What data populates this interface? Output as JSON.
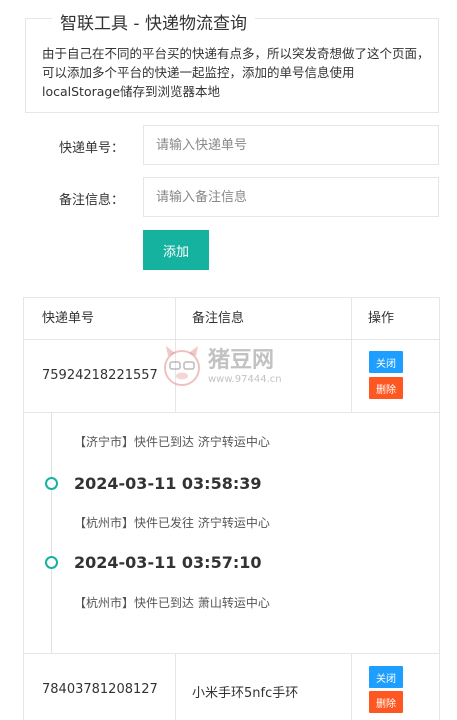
{
  "header": {
    "title": "智联工具 - 快递物流查询",
    "description": "由于自己在不同的平台买的快递有点多，所以突发奇想做了这个页面，可以添加多个平台的快递一起监控，添加的单号信息使用localStorage储存到浏览器本地"
  },
  "form": {
    "tracking_label": "快递单号：",
    "tracking_placeholder": "请输入快递单号",
    "tracking_value": "",
    "remark_label": "备注信息：",
    "remark_placeholder": "请输入备注信息",
    "remark_value": "",
    "add_label": "添加"
  },
  "table": {
    "headers": [
      "快递单号",
      "备注信息",
      "操作"
    ],
    "rows": [
      {
        "tracking": "75924218221557",
        "remark": "",
        "close_label": "关闭",
        "delete_label": "删除",
        "timeline": [
          {
            "desc": "【济宁市】快件已到达 济宁转运中心"
          },
          {
            "time": "2024-03-11 03:58:39",
            "desc": "【杭州市】快件已发往 济宁转运中心"
          },
          {
            "time": "2024-03-11 03:57:10",
            "desc": "【杭州市】快件已到达 萧山转运中心"
          }
        ]
      },
      {
        "tracking": "78403781208127",
        "remark": "小米手环5nfc手环",
        "close_label": "关闭",
        "delete_label": "删除"
      }
    ]
  },
  "watermark": {
    "text": "猪豆网",
    "url": "www.97444.cn"
  },
  "colors": {
    "primary": "#16b2a0",
    "blue": "#1e9fff",
    "red": "#ff5722",
    "border": "#e6e6e6"
  }
}
